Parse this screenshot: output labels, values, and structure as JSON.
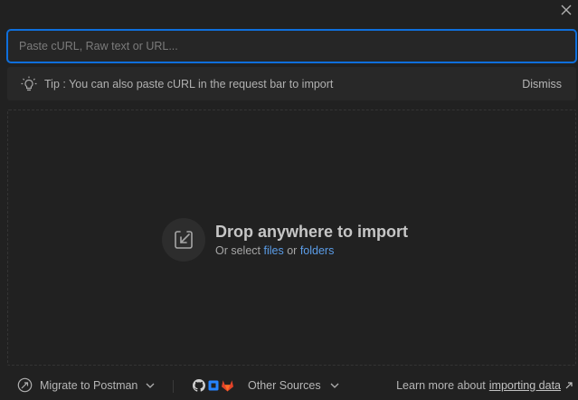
{
  "input": {
    "placeholder": "Paste cURL, Raw text or URL..."
  },
  "tip": {
    "text": "Tip : You can also paste cURL in the request bar to import",
    "dismiss_label": "Dismiss",
    "icon": "lightbulb-icon"
  },
  "dropzone": {
    "title": "Drop anywhere to import",
    "prefix": "Or select",
    "files_link": "files",
    "connector": "or",
    "folders_link": "folders",
    "icon": "import-arrow-icon"
  },
  "footer": {
    "migrate_label": "Migrate to Postman",
    "other_label": "Other Sources",
    "learn_prefix": "Learn more about",
    "learn_link": "importing data",
    "icons": [
      "github-icon",
      "bitbucket-icon",
      "gitlab-icon"
    ]
  },
  "colors": {
    "accent": "#0f6fdc",
    "link": "#5b9de8",
    "background": "#212121",
    "gitlab": "#e24329",
    "bitbucket": "#2684ff"
  }
}
